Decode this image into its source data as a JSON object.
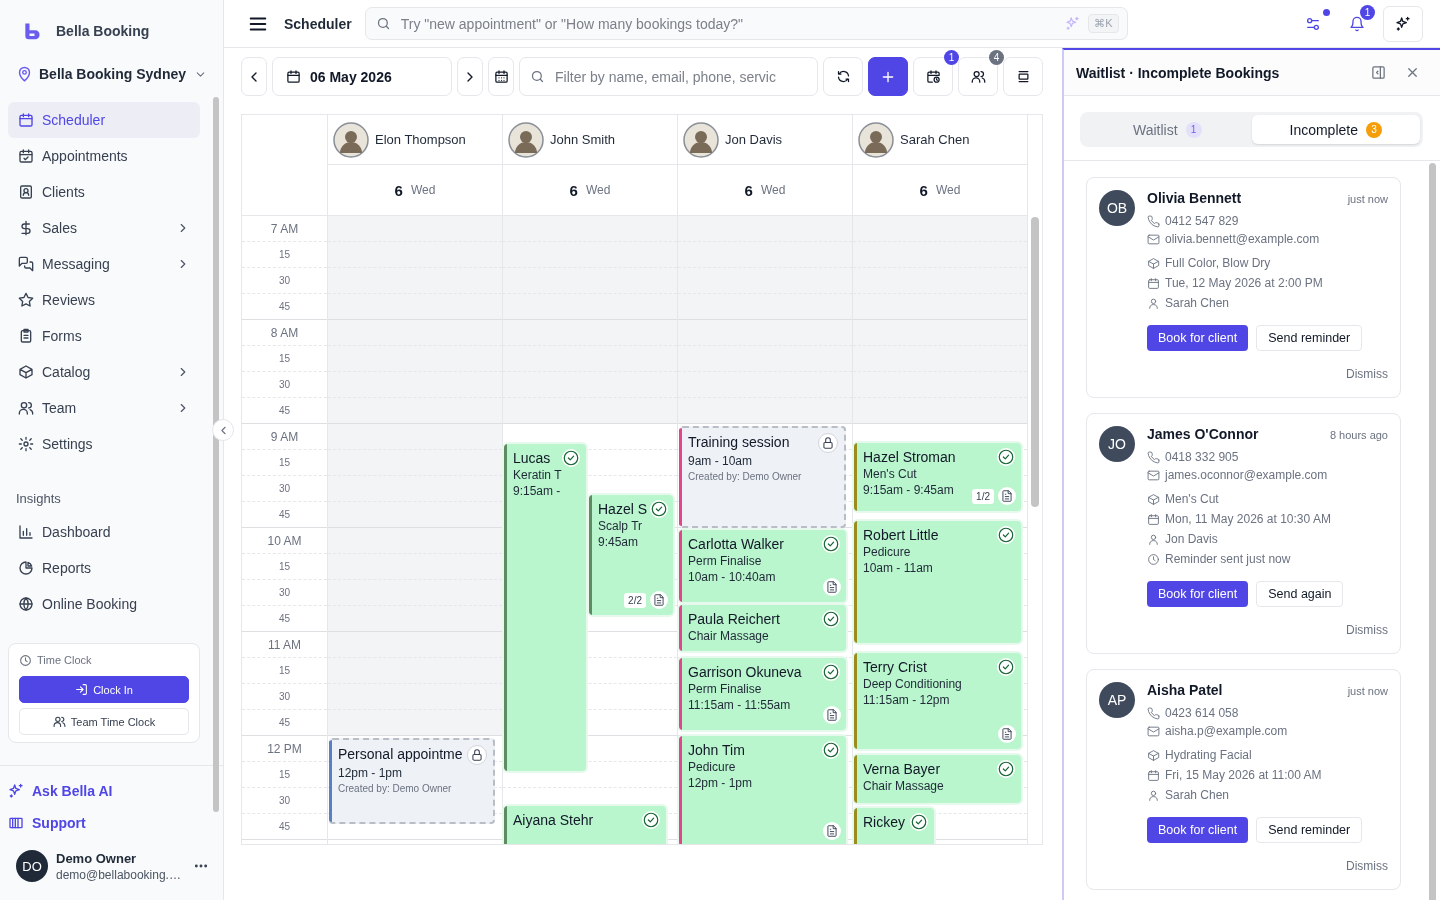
{
  "sidebar": {
    "brand": "Bella Booking",
    "location": "Bella Booking Sydney",
    "nav": [
      {
        "label": "Scheduler",
        "selected": true,
        "submenu": false
      },
      {
        "label": "Appointments",
        "selected": false,
        "submenu": false
      },
      {
        "label": "Clients",
        "selected": false,
        "submenu": false
      },
      {
        "label": "Sales",
        "selected": false,
        "submenu": true
      },
      {
        "label": "Messaging",
        "selected": false,
        "submenu": true
      },
      {
        "label": "Reviews",
        "selected": false,
        "submenu": false
      },
      {
        "label": "Forms",
        "selected": false,
        "submenu": false
      },
      {
        "label": "Catalog",
        "selected": false,
        "submenu": true
      },
      {
        "label": "Team",
        "selected": false,
        "submenu": true
      },
      {
        "label": "Settings",
        "selected": false,
        "submenu": false
      }
    ],
    "insights_title": "Insights",
    "insights": [
      {
        "label": "Dashboard",
        "selected": false
      },
      {
        "label": "Reports",
        "selected": false
      },
      {
        "label": "Online Booking",
        "selected": false
      }
    ],
    "time_clock": {
      "title": "Time Clock",
      "clock_in": "Clock In",
      "team": "Team Time Clock"
    },
    "links": [
      "Ask Bella AI",
      "Support"
    ],
    "user": {
      "initials": "DO",
      "name": "Demo Owner",
      "email": "demo@bellabooking.…"
    }
  },
  "topbar": {
    "title": "Scheduler",
    "search_placeholder": "Try \"new appointment\" or \"How many bookings today?\"",
    "shortcut": "⌘K",
    "filter_dot": true,
    "notifications": "1"
  },
  "toolbar": {
    "date": "06 May 2026",
    "filter_placeholder": "Filter by name, email, phone, servic",
    "waitlist_count": "1",
    "team_count": "4"
  },
  "calendar": {
    "time_labels": [
      "7 AM",
      "15",
      "30",
      "45",
      "8 AM",
      "15",
      "30",
      "45",
      "9 AM",
      "15",
      "30",
      "45",
      "10 AM",
      "15",
      "30",
      "45",
      "11 AM",
      "15",
      "30",
      "45",
      "12 PM",
      "15",
      "30",
      "45"
    ],
    "staff": [
      {
        "name": "Elon Thompson",
        "day": "6",
        "weekday": "Wed",
        "events": [
          {
            "kind": "blocked",
            "title": "Personal appointme",
            "time": "12pm - 1pm",
            "note": "Created by: Demo Owner",
            "color": "#5b7fc0",
            "locked": true
          }
        ]
      },
      {
        "name": "John Smith",
        "day": "6",
        "weekday": "Wed",
        "events": [
          {
            "kind": "appointment",
            "name": "Lucas",
            "service": "Keratin T",
            "time": "9:15am -",
            "color": "#5f8a62",
            "confirmed": true,
            "notes": false
          },
          {
            "kind": "appointment",
            "name": "Hazel S",
            "service": "Scalp Tr",
            "time": "9:45am",
            "color": "#5f8a62",
            "confirmed": true,
            "notes": true,
            "badge": "2/2"
          },
          {
            "kind": "appointment",
            "name": "Aiyana Stehr",
            "color": "#5f8a62",
            "confirmed": true,
            "notes": false
          }
        ]
      },
      {
        "name": "Jon Davis",
        "day": "6",
        "weekday": "Wed",
        "events": [
          {
            "kind": "blocked",
            "title": "Training session",
            "time": "9am - 10am",
            "note": "Created by: Demo Owner",
            "color": "#e0468c",
            "locked": true
          },
          {
            "kind": "appointment",
            "name": "Carlotta Walker",
            "service": "Perm Finalise",
            "time": "10am - 10:40am",
            "color": "#e0468c",
            "confirmed": true,
            "notes": true
          },
          {
            "kind": "appointment",
            "name": "Paula Reichert",
            "service": "Chair Massage",
            "color": "#e0468c",
            "confirmed": true,
            "notes": false
          },
          {
            "kind": "appointment",
            "name": "Garrison Okuneva",
            "service": "Perm Finalise",
            "time": "11:15am - 11:55am",
            "color": "#e0468c",
            "confirmed": true,
            "notes": true
          },
          {
            "kind": "appointment",
            "name": "John Tim",
            "service": "Pedicure",
            "time": "12pm - 1pm",
            "color": "#e0468c",
            "confirmed": true,
            "notes": true
          }
        ]
      },
      {
        "name": "Sarah Chen",
        "day": "6",
        "weekday": "Wed",
        "events": [
          {
            "kind": "appointment",
            "name": "Hazel Stroman",
            "service": "Men's Cut",
            "time": "9:15am - 9:45am",
            "color": "#9a8c1e",
            "confirmed": true,
            "notes": true,
            "badge": "1/2"
          },
          {
            "kind": "appointment",
            "name": "Robert Little",
            "service": "Pedicure",
            "time": "10am - 11am",
            "color": "#9a8c1e",
            "confirmed": true,
            "notes": false
          },
          {
            "kind": "appointment",
            "name": "Terry Crist",
            "service": "Deep Conditioning",
            "time": "11:15am - 12pm",
            "color": "#9a8c1e",
            "confirmed": true,
            "notes": true
          },
          {
            "kind": "appointment",
            "name": "Verna Bayer",
            "service": "Chair Massage",
            "color": "#9a8c1e",
            "confirmed": true,
            "notes": false
          },
          {
            "kind": "appointment",
            "name": "Rickey",
            "color": "#9a8c1e",
            "confirmed": true,
            "notes": false
          }
        ]
      }
    ]
  },
  "panel": {
    "title": "Waitlist · Incomplete Bookings",
    "tabs": [
      {
        "label": "Waitlist",
        "count": "1",
        "color": "#e3e0fb",
        "selected": false
      },
      {
        "label": "Incomplete",
        "count": "3",
        "color": "#f59e0b",
        "selected": true
      }
    ],
    "cards": [
      {
        "initials": "OB",
        "name": "Olivia Bennett",
        "time": "just now",
        "details": [
          {
            "kind": "phone",
            "text": "0412 547 829"
          },
          {
            "kind": "email",
            "text": "olivia.bennett@example.com"
          },
          {
            "kind": "service",
            "text": "Full Color, Blow Dry"
          },
          {
            "kind": "date",
            "text": "Tue, 12 May 2026 at 2:00 PM"
          },
          {
            "kind": "staff",
            "text": "Sarah Chen"
          }
        ],
        "primary": "Book for client",
        "secondary": "Send reminder",
        "dismiss": "Dismiss"
      },
      {
        "initials": "JO",
        "name": "James O'Connor",
        "time": "8 hours ago",
        "details": [
          {
            "kind": "phone",
            "text": "0418 332 905"
          },
          {
            "kind": "email",
            "text": "james.oconnor@example.com"
          },
          {
            "kind": "service",
            "text": "Men's Cut"
          },
          {
            "kind": "date",
            "text": "Mon, 11 May 2026 at 10:30 AM"
          },
          {
            "kind": "staff",
            "text": "Jon Davis"
          },
          {
            "kind": "reminder",
            "text": "Reminder sent just now"
          }
        ],
        "primary": "Book for client",
        "secondary": "Send again",
        "dismiss": "Dismiss"
      },
      {
        "initials": "AP",
        "name": "Aisha Patel",
        "time": "just now",
        "details": [
          {
            "kind": "phone",
            "text": "0423 614 058"
          },
          {
            "kind": "email",
            "text": "aisha.p@example.com"
          },
          {
            "kind": "service",
            "text": "Hydrating Facial"
          },
          {
            "kind": "date",
            "text": "Fri, 15 May 2026 at 11:00 AM"
          },
          {
            "kind": "staff",
            "text": "Sarah Chen"
          }
        ],
        "primary": "Book for client",
        "secondary": "Send reminder",
        "dismiss": "Dismiss"
      }
    ]
  }
}
